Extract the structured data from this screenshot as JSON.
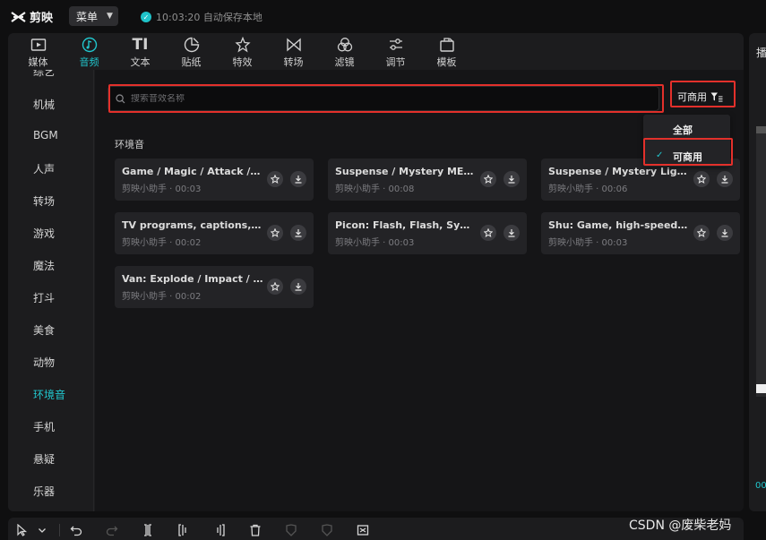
{
  "app": {
    "name": "剪映",
    "menu_label": "菜单",
    "save_status": "10:03:20 自动保存本地"
  },
  "tabs": [
    {
      "label": "媒体",
      "icon": "media-icon"
    },
    {
      "label": "音频",
      "icon": "audio-icon",
      "active": true
    },
    {
      "label": "文本",
      "icon": "text-icon"
    },
    {
      "label": "贴纸",
      "icon": "sticker-icon"
    },
    {
      "label": "特效",
      "icon": "effects-icon"
    },
    {
      "label": "转场",
      "icon": "transition-icon"
    },
    {
      "label": "滤镜",
      "icon": "filter-icon"
    },
    {
      "label": "调节",
      "icon": "adjust-icon"
    },
    {
      "label": "模板",
      "icon": "template-icon"
    }
  ],
  "text_tab_glyph": "TI",
  "sidebar": {
    "partial_top": "综艺",
    "items": [
      {
        "label": "机械"
      },
      {
        "label": "BGM"
      },
      {
        "label": "人声"
      },
      {
        "label": "转场"
      },
      {
        "label": "游戏"
      },
      {
        "label": "魔法"
      },
      {
        "label": "打斗"
      },
      {
        "label": "美食"
      },
      {
        "label": "动物"
      },
      {
        "label": "环境音",
        "active": true
      },
      {
        "label": "手机"
      },
      {
        "label": "悬疑"
      },
      {
        "label": "乐器"
      }
    ]
  },
  "search": {
    "placeholder": "搜索音效名称",
    "value": ""
  },
  "filter": {
    "label": "可商用",
    "options": [
      "全部",
      "可商用"
    ],
    "selected": "可商用",
    "check_glyph": "✓"
  },
  "section_title": "环境音",
  "sounds": [
    {
      "title": "Game / Magic / Attack / C...",
      "meta": "剪映小助手 · 00:03"
    },
    {
      "title": "Suspense / Mystery ME Ta...",
      "meta": "剪映小助手 · 00:08"
    },
    {
      "title": "Suspense / Mystery Light ...",
      "meta": "剪映小助手 · 00:06"
    },
    {
      "title": "TV programs, captions, et...",
      "meta": "剪映小助手 · 00:02"
    },
    {
      "title": "Picon: Flash, Flash, Synthe...",
      "meta": "剪映小助手 · 00:03"
    },
    {
      "title": "Shu: Game, high-speed m...",
      "meta": "剪映小助手 · 00:03"
    },
    {
      "title": "Van: Explode / Impact / A...",
      "meta": "剪映小助手 · 00:02"
    }
  ],
  "right_panel": {
    "title": "播",
    "time": "00"
  },
  "watermark": "CSDN @废柴老妈",
  "colors": {
    "accent": "#21c6cd",
    "highlight_box": "#e3302b"
  }
}
